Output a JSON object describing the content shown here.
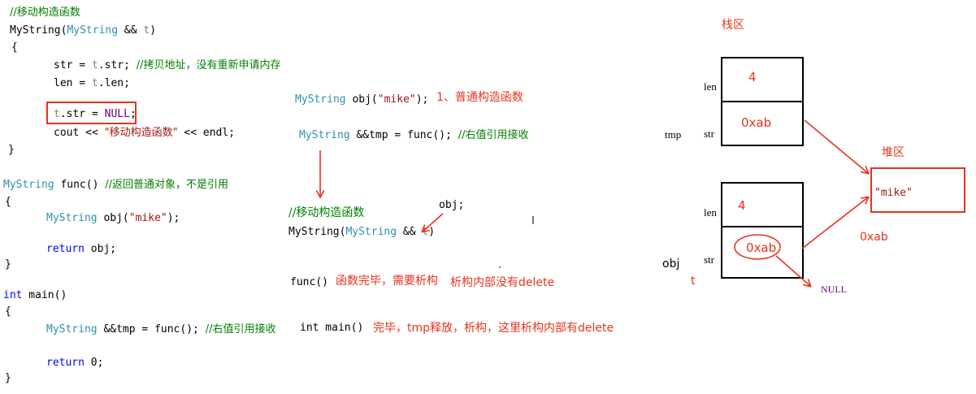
{
  "left_code": {
    "ctor_comment": "//移动构造函数",
    "ctor_name": "MyString(",
    "ctor_type": "MyString",
    "ctor_amp": " && ",
    "ctor_param": "t",
    "ctor_close": ")",
    "open_brace": "{",
    "line_str_a": "str = ",
    "line_str_b": "t",
    "line_str_c": ".str; ",
    "line_str_comment": "//拷贝地址，没有重新申请内存",
    "line_len_a": "len = ",
    "line_len_b": "t",
    "line_len_c": ".len;",
    "line_null_a": "t",
    "line_null_b": ".str = ",
    "line_null_c": "NULL",
    "line_null_d": ";",
    "line_cout_a": "cout << ",
    "line_cout_str": "\"移动构造函数\"",
    "line_cout_b": " << endl;",
    "close_brace": "}",
    "func_type": "MyString",
    "func_name": " func() ",
    "func_comment": "//返回普通对象，不是引用",
    "func_open": "{",
    "func_obj_type": "MyString",
    "func_obj_a": " obj(",
    "func_obj_str": "\"mike\"",
    "func_obj_b": ");",
    "func_return_kw": "return",
    "func_return_b": " obj;",
    "func_close": "}",
    "main_kw": "int",
    "main_b": " main()",
    "main_open": "{",
    "main_tmp_type": "MyString",
    "main_tmp_b": " &&tmp = func(); ",
    "main_tmp_comment": "//右值引用接收",
    "main_return_kw": "return",
    "main_return_b": " 0;",
    "main_close": "}"
  },
  "middle": {
    "obj_type": "MyString",
    "obj_a": " obj(",
    "obj_str": "\"mike\"",
    "obj_b": ");",
    "obj_note": "1、普通构造函数",
    "tmp_type": "MyString",
    "tmp_b": " &&tmp = func(); ",
    "tmp_comment": "//右值引用接收",
    "ctor_comment": "//移动构造函数",
    "ctor_name": "MyString(",
    "ctor_type": "MyString",
    "ctor_amp": " && ",
    "ctor_param": "t",
    "ctor_close": ")",
    "obj_label": "obj;",
    "func_call": "func()",
    "func_note1": "函数完毕，需要析构",
    "func_note2": "析构内部没有delete",
    "main_call": "int main()",
    "main_note": "完毕，tmp释放，析构，这里析构内部有delete",
    "dot": "."
  },
  "memory": {
    "stack_title": "栈区",
    "heap_title": "堆区",
    "tmp_label": "tmp",
    "obj_label": "obj",
    "t_label": "t",
    "len_label": "len",
    "str_label": "str",
    "tmp_len_value": "4",
    "tmp_str_value": "0xab",
    "obj_len_value": "4",
    "obj_str_value": "0xab",
    "heap_value": "\"mike\"",
    "heap_addr": "0xab",
    "null_label": "NULL"
  },
  "colors": {
    "annotation": "#e8321e",
    "comment": "#008000",
    "type": "#2b91af",
    "keyword": "#0000ff",
    "string": "#a31515"
  }
}
